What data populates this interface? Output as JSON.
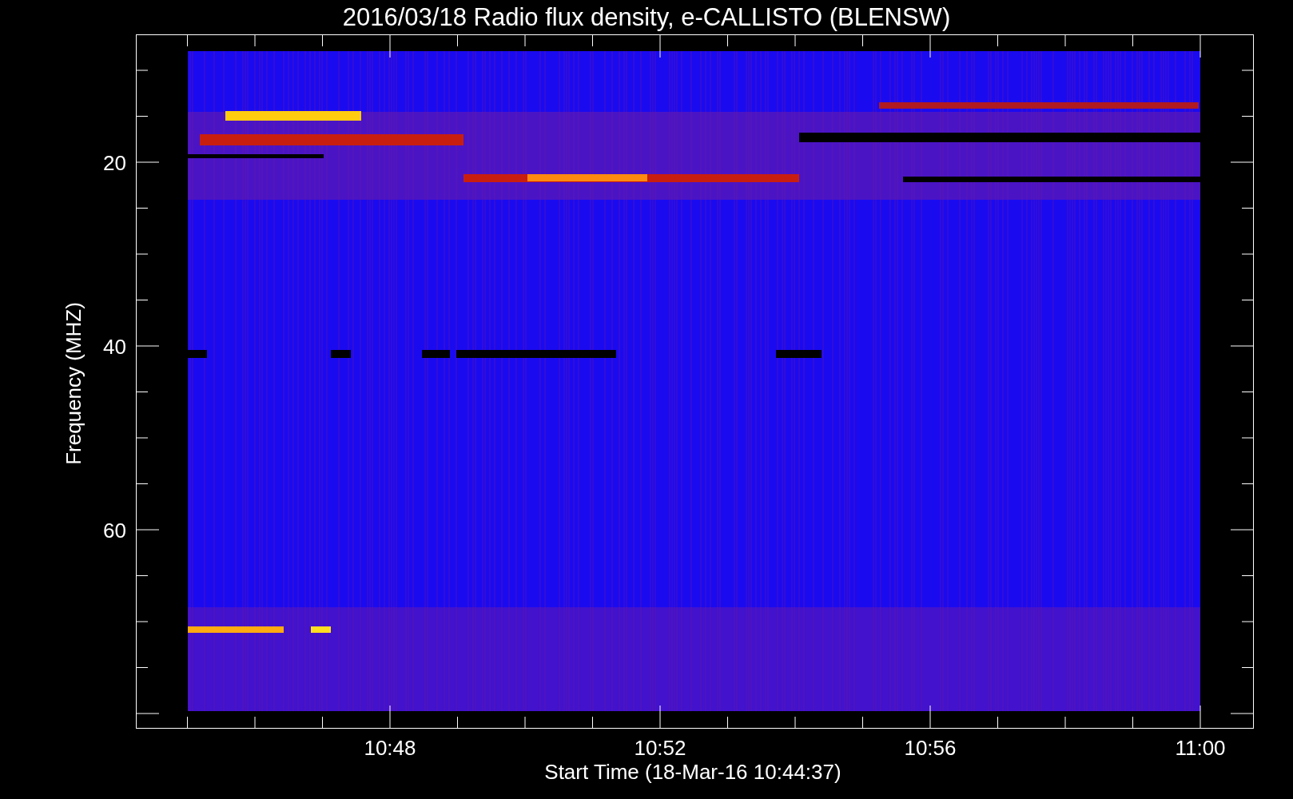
{
  "title": "2016/03/18  Radio flux density, e-CALLISTO (BLENSW)",
  "y_axis": {
    "label": "Frequency (MHZ)",
    "ticks": [
      "20",
      "40",
      "60"
    ]
  },
  "x_axis": {
    "label": "Start Time (18-Mar-16 10:44:37)",
    "ticks": [
      "10:48",
      "10:52",
      "10:56",
      "11:00"
    ]
  }
}
